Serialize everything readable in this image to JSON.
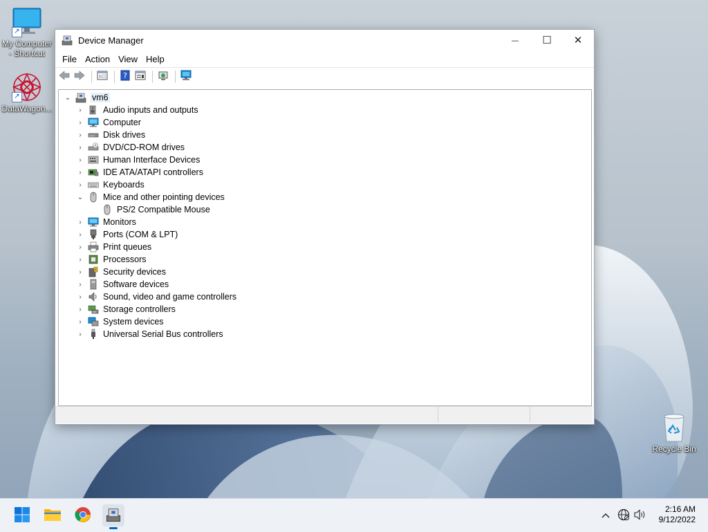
{
  "desktop": {
    "icons": [
      {
        "label": "My Computer - Shortcut"
      },
      {
        "label": "DataWagon..."
      }
    ],
    "recycle_bin": {
      "label": "Recycle Bin"
    }
  },
  "window": {
    "title": "Device Manager",
    "controls": {
      "minimize": "—",
      "maximize": "☐",
      "close": "✕"
    },
    "menu": [
      "File",
      "Action",
      "View",
      "Help"
    ],
    "tree": {
      "root": "vm6",
      "categories": [
        {
          "label": "Audio inputs and outputs",
          "icon": "speaker-icon",
          "expanded": false
        },
        {
          "label": "Computer",
          "icon": "computer-icon",
          "expanded": false
        },
        {
          "label": "Disk drives",
          "icon": "disk-drive-icon",
          "expanded": false
        },
        {
          "label": "DVD/CD-ROM drives",
          "icon": "dvd-drive-icon",
          "expanded": false
        },
        {
          "label": "Human Interface Devices",
          "icon": "hid-icon",
          "expanded": false
        },
        {
          "label": "IDE ATA/ATAPI controllers",
          "icon": "ide-controller-icon",
          "expanded": false
        },
        {
          "label": "Keyboards",
          "icon": "keyboard-icon",
          "expanded": false
        },
        {
          "label": "Mice and other pointing devices",
          "icon": "mouse-icon",
          "expanded": true,
          "children": [
            {
              "label": "PS/2 Compatible Mouse",
              "icon": "mouse-icon"
            }
          ]
        },
        {
          "label": "Monitors",
          "icon": "monitor-icon",
          "expanded": false
        },
        {
          "label": "Ports (COM & LPT)",
          "icon": "port-icon",
          "expanded": false
        },
        {
          "label": "Print queues",
          "icon": "printer-icon",
          "expanded": false
        },
        {
          "label": "Processors",
          "icon": "processor-icon",
          "expanded": false
        },
        {
          "label": "Security devices",
          "icon": "security-device-icon",
          "expanded": false
        },
        {
          "label": "Software devices",
          "icon": "software-device-icon",
          "expanded": false
        },
        {
          "label": "Sound, video and game controllers",
          "icon": "sound-icon",
          "expanded": false
        },
        {
          "label": "Storage controllers",
          "icon": "storage-controller-icon",
          "expanded": false
        },
        {
          "label": "System devices",
          "icon": "system-device-icon",
          "expanded": false
        },
        {
          "label": "Universal Serial Bus controllers",
          "icon": "usb-icon",
          "expanded": false
        }
      ]
    }
  },
  "taskbar": {
    "clock": {
      "time": "2:16 AM",
      "date": "9/12/2022"
    }
  },
  "colors": {
    "accent": "#0067c0",
    "selection": "#e5f1fb"
  }
}
